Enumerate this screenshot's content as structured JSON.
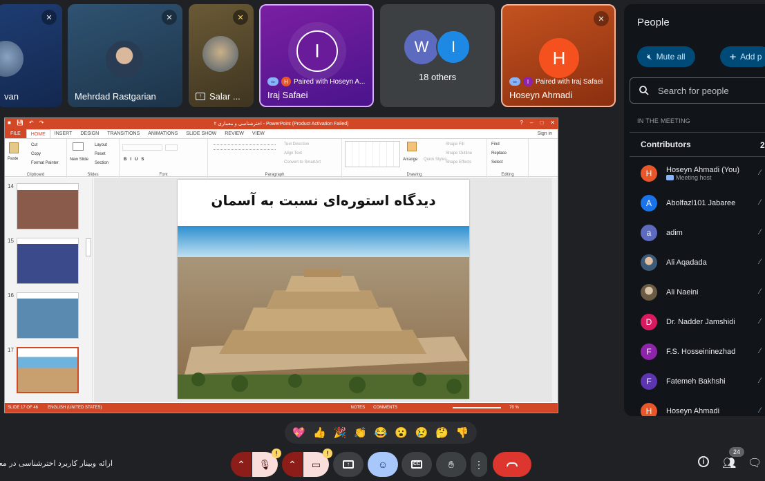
{
  "tiles": [
    {
      "name": "van",
      "bg": "#1f3b6b"
    },
    {
      "name": "Mehrdad Rastgarian",
      "bg": "#2b4a66"
    },
    {
      "name": "Salar ...",
      "bg": "#5a4a2c"
    },
    {
      "name": "Iraj Safaei",
      "letter": "I",
      "bg": "#6a1b9a",
      "paired": "Paired with Hoseyn A...",
      "paired_letter": "H",
      "paired_color": "#e8572a"
    },
    {
      "letters": [
        "W",
        "I"
      ],
      "label": "18 others",
      "bg": "#3c4043"
    },
    {
      "name": "Hoseyn Ahmadi",
      "letter": "H",
      "bg": "#b8461b",
      "paired": "Paired with Iraj Safaei",
      "paired_letter": "I",
      "paired_color": "#8e24aa"
    }
  ],
  "people_panel": {
    "title": "People",
    "mute_all": "Mute all",
    "add_people": "Add p",
    "search_placeholder": "Search for people",
    "section_label": "IN THE MEETING",
    "contributors_label": "Contributors",
    "contributors_count": "2",
    "people": [
      {
        "name": "Hoseyn Ahmadi (You)",
        "sub": "Meeting host",
        "letter": "H",
        "color": "#e8572a"
      },
      {
        "name": "Abolfazl101 Jabaree",
        "letter": "A",
        "color": "#1a73e8"
      },
      {
        "name": "adim",
        "letter": "a",
        "color": "#5c6bc0"
      },
      {
        "name": "Ali Aqadada",
        "photo": true,
        "color": "#7b8a99"
      },
      {
        "name": "Ali Naeini",
        "photo": true,
        "color": "#a08a70"
      },
      {
        "name": "Dr. Nadder Jamshidi",
        "letter": "D",
        "color": "#d81b60"
      },
      {
        "name": "F.S. Hosseininezhad",
        "letter": "F",
        "color": "#8e24aa"
      },
      {
        "name": "Fatemeh Bakhshi",
        "letter": "F",
        "color": "#5e35b1"
      },
      {
        "name": "Hoseyn Ahmadi",
        "letter": "H",
        "color": "#e8572a"
      }
    ]
  },
  "ppt": {
    "window_title": "اختر‌شناسی و معماری ۲ - PowerPoint (Product Activation Failed)",
    "tabs": [
      "FILE",
      "HOME",
      "INSERT",
      "DESIGN",
      "TRANSITIONS",
      "ANIMATIONS",
      "SLIDE SHOW",
      "REVIEW",
      "VIEW"
    ],
    "sign_in": "Sign in",
    "ribbon": {
      "paste": "Paste",
      "cut": "Cut",
      "copy": "Copy",
      "format_painter": "Format Painter",
      "clipboard": "Clipboard",
      "new_slide": "New Slide",
      "layout": "Layout",
      "reset": "Reset",
      "section": "Section",
      "slides": "Slides",
      "font": "Font",
      "text_direction": "Text Direction",
      "align_text": "Align Text",
      "convert_smartart": "Convert to SmartArt",
      "paragraph": "Paragraph",
      "arrange": "Arrange",
      "quick_styles": "Quick Styles",
      "shape_fill": "Shape Fill",
      "shape_outline": "Shape Outline",
      "shape_effects": "Shape Effects",
      "drawing": "Drawing",
      "find": "Find",
      "replace": "Replace",
      "select": "Select",
      "editing": "Editing"
    },
    "thumb_numbers": [
      "14",
      "15",
      "16",
      "17"
    ],
    "slide_title": "دیدگاه استوره‌ای نسبت به آسمان",
    "status": {
      "slide": "SLIDE 17 OF 46",
      "language": "ENGLISH (UNITED STATES)",
      "notes": "NOTES",
      "comments": "COMMENTS",
      "zoom": "70 %"
    }
  },
  "reactions": [
    "💖",
    "👍",
    "🎉",
    "👏",
    "😂",
    "😮",
    "😢",
    "🤔",
    "👎"
  ],
  "meeting_title": "ارائه وبینار کاربرد اخترشناسی در معماری",
  "participant_count": "24"
}
